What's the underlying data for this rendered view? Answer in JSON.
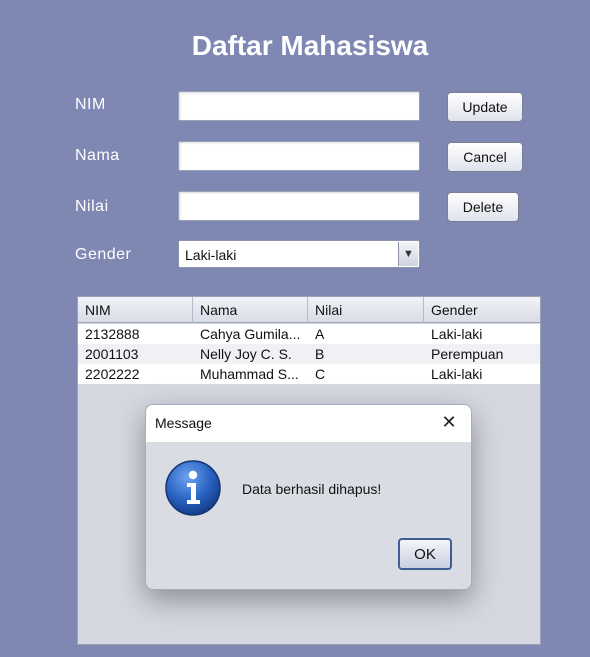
{
  "form": {
    "title": "Daftar Mahasiswa",
    "nim_label": "NIM",
    "nama_label": "Nama",
    "nilai_label": "Nilai",
    "gender_label": "Gender",
    "nim_value": "",
    "nama_value": "",
    "nilai_value": "",
    "gender_selected": "Laki-laki"
  },
  "buttons": {
    "update": "Update",
    "cancel": "Cancel",
    "delete": "Delete"
  },
  "table": {
    "headers": [
      "NIM",
      "Nama",
      "Nilai",
      "Gender"
    ],
    "rows": [
      [
        "2132888",
        "Cahya Gumila...",
        "A",
        "Laki-laki"
      ],
      [
        "2001103",
        "Nelly Joy C. S.",
        "B",
        "Perempuan"
      ],
      [
        "2202222",
        "Muhammad S...",
        "C",
        "Laki-laki"
      ]
    ]
  },
  "dialog": {
    "title": "Message",
    "close_icon": "close-icon",
    "icon": "info-icon",
    "message": "Data berhasil dihapus!",
    "ok_label": "OK"
  },
  "colors": {
    "background": "#7f87b3",
    "dialog_bg": "#dadce3",
    "ok_border": "#3d5f95",
    "info_blue": "#1f5fbf"
  }
}
